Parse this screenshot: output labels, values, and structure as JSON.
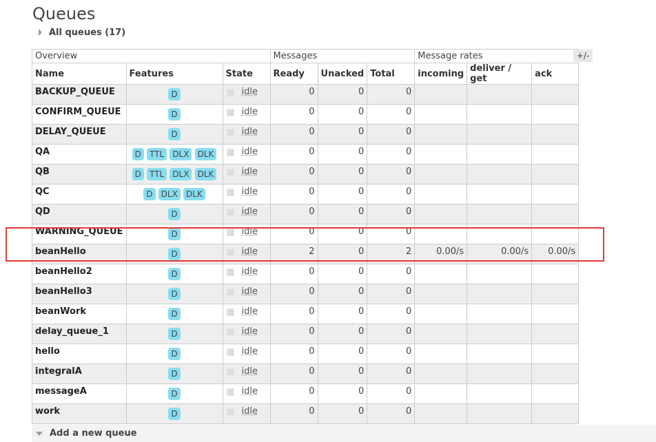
{
  "page": {
    "title": "Queues",
    "all_queues": "All queues (17)"
  },
  "groups": {
    "overview": "Overview",
    "messages": "Messages",
    "message_rates": "Message rates",
    "toggle": "+/-"
  },
  "columns": {
    "name": "Name",
    "features": "Features",
    "state": "State",
    "ready": "Ready",
    "unacked": "Unacked",
    "total": "Total",
    "incoming": "incoming",
    "deliver_get": "deliver / get",
    "ack": "ack"
  },
  "queues": [
    {
      "name": "BACKUP_QUEUE",
      "features": [
        "D"
      ],
      "state": "idle",
      "ready": "0",
      "unacked": "0",
      "total": "0",
      "incoming": "",
      "deliver_get": "",
      "ack": ""
    },
    {
      "name": "CONFIRM_QUEUE",
      "features": [
        "D"
      ],
      "state": "idle",
      "ready": "0",
      "unacked": "0",
      "total": "0",
      "incoming": "",
      "deliver_get": "",
      "ack": ""
    },
    {
      "name": "DELAY_QUEUE",
      "features": [
        "D"
      ],
      "state": "idle",
      "ready": "0",
      "unacked": "0",
      "total": "0",
      "incoming": "",
      "deliver_get": "",
      "ack": ""
    },
    {
      "name": "QA",
      "features": [
        "D",
        "TTL",
        "DLX",
        "DLK"
      ],
      "state": "idle",
      "ready": "0",
      "unacked": "0",
      "total": "0",
      "incoming": "",
      "deliver_get": "",
      "ack": ""
    },
    {
      "name": "QB",
      "features": [
        "D",
        "TTL",
        "DLX",
        "DLK"
      ],
      "state": "idle",
      "ready": "0",
      "unacked": "0",
      "total": "0",
      "incoming": "",
      "deliver_get": "",
      "ack": ""
    },
    {
      "name": "QC",
      "features": [
        "D",
        "DLX",
        "DLK"
      ],
      "state": "idle",
      "ready": "0",
      "unacked": "0",
      "total": "0",
      "incoming": "",
      "deliver_get": "",
      "ack": ""
    },
    {
      "name": "QD",
      "features": [
        "D"
      ],
      "state": "idle",
      "ready": "0",
      "unacked": "0",
      "total": "0",
      "incoming": "",
      "deliver_get": "",
      "ack": ""
    },
    {
      "name": "WARNING_QUEUE",
      "features": [
        "D"
      ],
      "state": "idle",
      "ready": "0",
      "unacked": "0",
      "total": "0",
      "incoming": "",
      "deliver_get": "",
      "ack": ""
    },
    {
      "name": "beanHello",
      "features": [
        "D"
      ],
      "state": "idle",
      "ready": "2",
      "unacked": "0",
      "total": "2",
      "incoming": "0.00/s",
      "deliver_get": "0.00/s",
      "ack": "0.00/s"
    },
    {
      "name": "beanHello2",
      "features": [
        "D"
      ],
      "state": "idle",
      "ready": "0",
      "unacked": "0",
      "total": "0",
      "incoming": "",
      "deliver_get": "",
      "ack": ""
    },
    {
      "name": "beanHello3",
      "features": [
        "D"
      ],
      "state": "idle",
      "ready": "0",
      "unacked": "0",
      "total": "0",
      "incoming": "",
      "deliver_get": "",
      "ack": ""
    },
    {
      "name": "beanWork",
      "features": [
        "D"
      ],
      "state": "idle",
      "ready": "0",
      "unacked": "0",
      "total": "0",
      "incoming": "",
      "deliver_get": "",
      "ack": ""
    },
    {
      "name": "delay_queue_1",
      "features": [
        "D"
      ],
      "state": "idle",
      "ready": "0",
      "unacked": "0",
      "total": "0",
      "incoming": "",
      "deliver_get": "",
      "ack": ""
    },
    {
      "name": "hello",
      "features": [
        "D"
      ],
      "state": "idle",
      "ready": "0",
      "unacked": "0",
      "total": "0",
      "incoming": "",
      "deliver_get": "",
      "ack": ""
    },
    {
      "name": "integralA",
      "features": [
        "D"
      ],
      "state": "idle",
      "ready": "0",
      "unacked": "0",
      "total": "0",
      "incoming": "",
      "deliver_get": "",
      "ack": ""
    },
    {
      "name": "messageA",
      "features": [
        "D"
      ],
      "state": "idle",
      "ready": "0",
      "unacked": "0",
      "total": "0",
      "incoming": "",
      "deliver_get": "",
      "ack": ""
    },
    {
      "name": "work",
      "features": [
        "D"
      ],
      "state": "idle",
      "ready": "0",
      "unacked": "0",
      "total": "0",
      "incoming": "",
      "deliver_get": "",
      "ack": ""
    }
  ],
  "add_queue": {
    "label": "Add a new queue"
  },
  "colors": {
    "badge": "#88ddf0",
    "highlight": "#e53935",
    "row_alt": "#eeeeee"
  }
}
